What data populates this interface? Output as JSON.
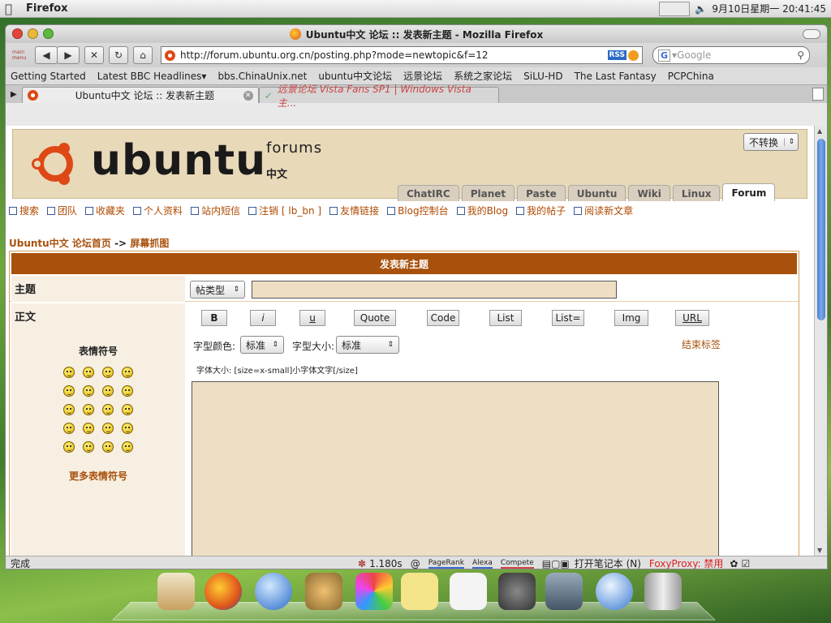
{
  "system": {
    "app_name": "Firefox",
    "datetime": "9月10日星期一 20:41:45"
  },
  "window": {
    "title": "Ubuntu中文 论坛 :: 发表新主题 - Mozilla Firefox"
  },
  "nav": {
    "main_menu": "main menu",
    "url": "http://forum.ubuntu.org.cn/posting.php?mode=newtopic&f=12",
    "rss": "RSS",
    "search_placeholder": "Google",
    "search_engine": "G"
  },
  "bookmarks": [
    "Getting Started",
    "Latest BBC Headlines▾",
    "bbs.ChinaUnix.net",
    "ubuntu中文论坛",
    "远景论坛",
    "系统之家论坛",
    "SiLU-HD",
    "The Last Fantasy",
    "PCPChina"
  ],
  "tabs": [
    {
      "label": "Ubuntu中文 论坛 :: 发表新主题"
    },
    {
      "label": "远景论坛 Vista Fans SP1 | Windows Vista 主..."
    }
  ],
  "header": {
    "logo_word": "ubuntu",
    "forums": "forums",
    "zh": "中文",
    "convert_select": "不转换"
  },
  "site_tabs": [
    "ChatIRC",
    "Planet",
    "Paste",
    "Ubuntu",
    "Wiki",
    "Linux",
    "Forum"
  ],
  "site_links": [
    "搜索",
    "团队",
    "收藏夹",
    "个人资料",
    "站内短信",
    "注销 [ lb_bn ]",
    "友情链接",
    "Blog控制台",
    "我的Blog",
    "我的帖子",
    "阅读新文章"
  ],
  "breadcrumb": {
    "home": "Ubuntu中文 论坛首页",
    "sep": "->",
    "current": "屏幕抓图"
  },
  "form": {
    "heading": "发表新主题",
    "subject_label": "主题",
    "post_type": "帖类型",
    "body_label": "正文",
    "smilies_title": "表情符号",
    "more_smilies": "更多表情符号",
    "buttons": [
      "B",
      "i",
      "u",
      "Quote",
      "Code",
      "List",
      "List=",
      "Img",
      "URL"
    ],
    "font_color_label": "字型颜色:",
    "font_color_value": "标准",
    "font_size_label": "字型大小:",
    "font_size_value": "标准",
    "close_tags": "结束标签",
    "help_line": "字体大小: [size=x-small]小字体文字[/size]"
  },
  "status": {
    "text": "完成",
    "load_time": "1.180s",
    "pagerank": "PageRank",
    "alexa": "Alexa",
    "compete": "Compete",
    "notebook": "打开笔记本 (N)",
    "foxyproxy": "FoxyProxy: 禁用"
  },
  "colors": {
    "brand_brown": "#a8510c",
    "header_bg": "#e8d9b8",
    "textarea_bg": "#eedfc4",
    "foxy_red": "#d22"
  }
}
